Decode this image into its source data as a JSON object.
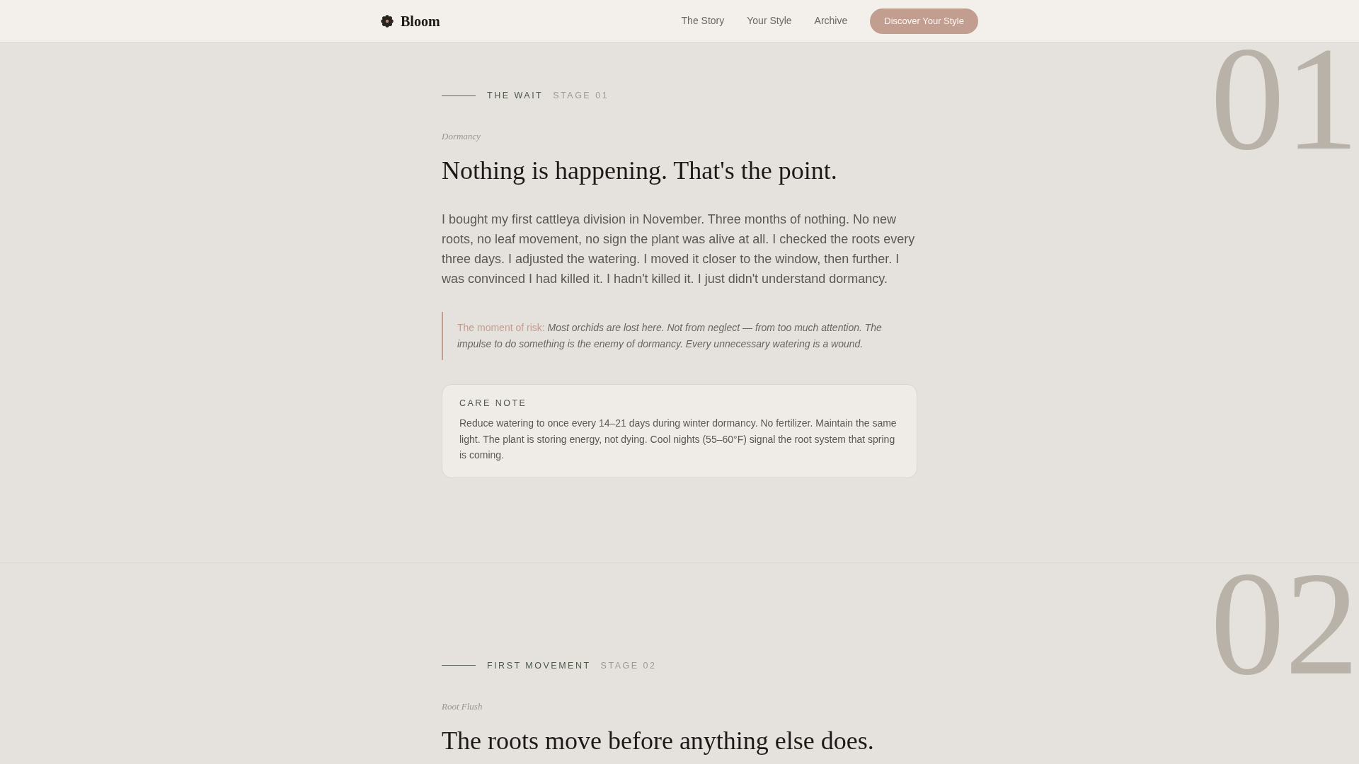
{
  "nav": {
    "brand": "Bloom",
    "links": [
      "The Story",
      "Your Style",
      "Archive"
    ],
    "cta": "Discover Your Style"
  },
  "stages": [
    {
      "number": "01",
      "title": "THE WAIT",
      "stage_label": "STAGE 01",
      "subtitle": "Dormancy",
      "heading": "Nothing is happening. That's the point.",
      "body": "I bought my first cattleya division in November. Three months of nothing. No new roots, no leaf movement, no sign the plant was alive at all. I checked the roots every three days. I adjusted the watering. I moved it closer to the window, then further. I was convinced I had killed it. I hadn't killed it. I just didn't understand dormancy.",
      "callout": {
        "label": "The moment of risk:",
        "text": "Most orchids are lost here. Not from neglect — from too much attention. The impulse to do something is the enemy of dormancy. Every unnecessary watering is a wound."
      },
      "care_note": {
        "title": "CARE NOTE",
        "text": "Reduce watering to once every 14–21 days during winter dormancy. No fertilizer. Maintain the same light. The plant is storing energy, not dying. Cool nights (55–60°F) signal the root system that spring is coming."
      }
    },
    {
      "number": "02",
      "title": "FIRST MOVEMENT",
      "stage_label": "STAGE 02",
      "subtitle": "Root Flush",
      "heading": "The roots move before anything else does."
    }
  ]
}
